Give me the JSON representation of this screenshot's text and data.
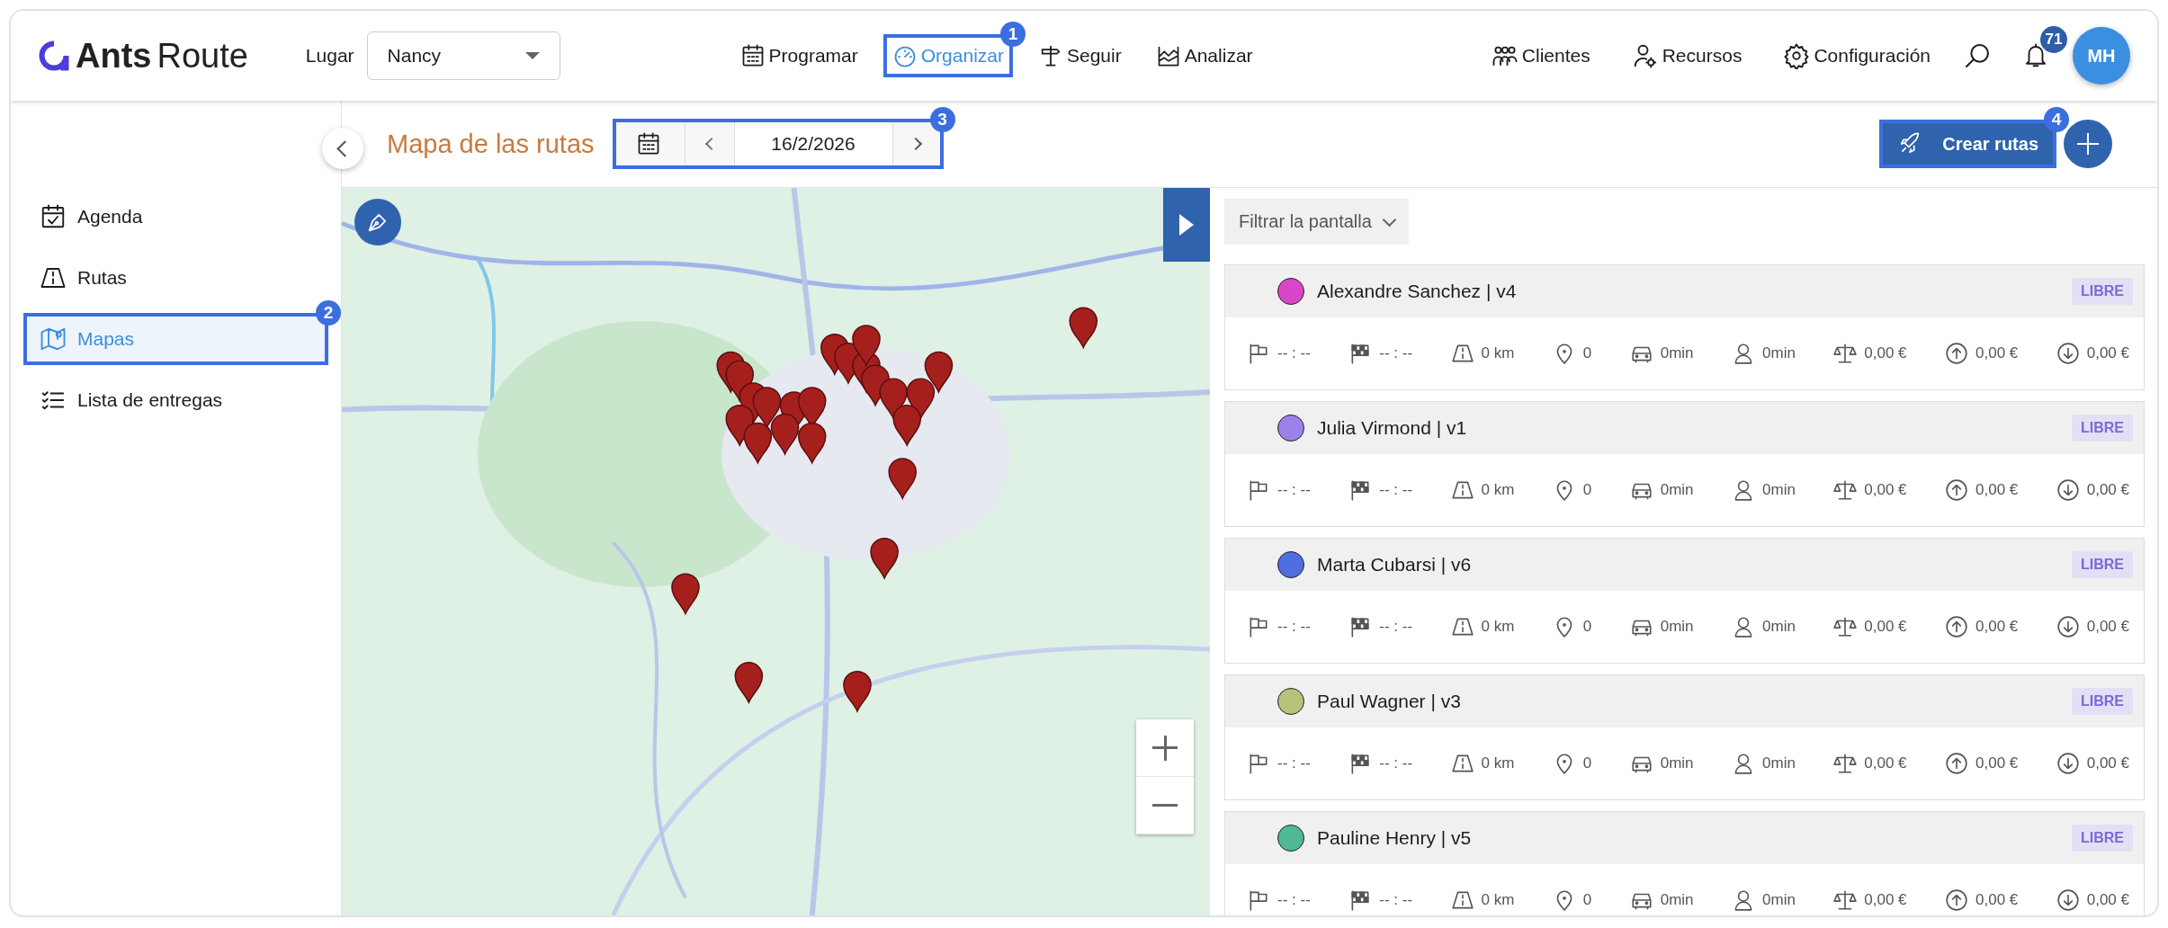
{
  "header": {
    "logo": {
      "bold": "Ants",
      "light": "Route"
    },
    "place": {
      "label": "Lugar",
      "value": "Nancy"
    },
    "nav": [
      {
        "label": "Programar",
        "selected": false
      },
      {
        "label": "Organizar",
        "selected": true,
        "callout": "1"
      },
      {
        "label": "Seguir",
        "selected": false
      },
      {
        "label": "Analizar",
        "selected": false
      }
    ],
    "right_nav": [
      {
        "label": "Clientes"
      },
      {
        "label": "Recursos"
      },
      {
        "label": "Configuración"
      }
    ],
    "notifications": "71",
    "avatar": "MH"
  },
  "sidebar": {
    "items": [
      {
        "label": "Agenda",
        "selected": false
      },
      {
        "label": "Rutas",
        "selected": false
      },
      {
        "label": "Mapas",
        "selected": true,
        "callout": "2"
      },
      {
        "label": "Lista de entregas",
        "selected": false
      }
    ]
  },
  "toolbar": {
    "title": "Mapa de las rutas",
    "date": "16/2/2026",
    "date_callout": "3",
    "create_button": "Crear rutas",
    "create_callout": "4"
  },
  "filter": {
    "label": "Filtrar la pantalla"
  },
  "routes": [
    {
      "name": "Alexandre Sanchez | v4",
      "color": "#d946c8",
      "status": "LIBRE",
      "stats": [
        {
          "kind": "start",
          "value": "-- : --"
        },
        {
          "kind": "end",
          "value": "-- : --"
        },
        {
          "kind": "distance",
          "value": "0 km"
        },
        {
          "kind": "stops",
          "value": "0"
        },
        {
          "kind": "drive",
          "value": "0min"
        },
        {
          "kind": "work",
          "value": "0min"
        },
        {
          "kind": "cost",
          "value": "0,00 €"
        },
        {
          "kind": "revenue",
          "value": "0,00 €"
        },
        {
          "kind": "expense",
          "value": "0,00 €"
        }
      ]
    },
    {
      "name": "Julia Virmond | v1",
      "color": "#9b82ea",
      "status": "LIBRE",
      "stats": [
        {
          "kind": "start",
          "value": "-- : --"
        },
        {
          "kind": "end",
          "value": "-- : --"
        },
        {
          "kind": "distance",
          "value": "0 km"
        },
        {
          "kind": "stops",
          "value": "0"
        },
        {
          "kind": "drive",
          "value": "0min"
        },
        {
          "kind": "work",
          "value": "0min"
        },
        {
          "kind": "cost",
          "value": "0,00 €"
        },
        {
          "kind": "revenue",
          "value": "0,00 €"
        },
        {
          "kind": "expense",
          "value": "0,00 €"
        }
      ]
    },
    {
      "name": "Marta Cubarsi | v6",
      "color": "#4f6fe0",
      "status": "LIBRE",
      "stats": [
        {
          "kind": "start",
          "value": "-- : --"
        },
        {
          "kind": "end",
          "value": "-- : --"
        },
        {
          "kind": "distance",
          "value": "0 km"
        },
        {
          "kind": "stops",
          "value": "0"
        },
        {
          "kind": "drive",
          "value": "0min"
        },
        {
          "kind": "work",
          "value": "0min"
        },
        {
          "kind": "cost",
          "value": "0,00 €"
        },
        {
          "kind": "revenue",
          "value": "0,00 €"
        },
        {
          "kind": "expense",
          "value": "0,00 €"
        }
      ]
    },
    {
      "name": "Paul Wagner | v3",
      "color": "#b9c27a",
      "status": "LIBRE",
      "stats": [
        {
          "kind": "start",
          "value": "-- : --"
        },
        {
          "kind": "end",
          "value": "-- : --"
        },
        {
          "kind": "distance",
          "value": "0 km"
        },
        {
          "kind": "stops",
          "value": "0"
        },
        {
          "kind": "drive",
          "value": "0min"
        },
        {
          "kind": "work",
          "value": "0min"
        },
        {
          "kind": "cost",
          "value": "0,00 €"
        },
        {
          "kind": "revenue",
          "value": "0,00 €"
        },
        {
          "kind": "expense",
          "value": "0,00 €"
        }
      ]
    },
    {
      "name": "Pauline Henry | v5",
      "color": "#4fb894",
      "status": "LIBRE",
      "stats": [
        {
          "kind": "start",
          "value": "-- : --"
        },
        {
          "kind": "end",
          "value": "-- : --"
        },
        {
          "kind": "distance",
          "value": "0 km"
        },
        {
          "kind": "stops",
          "value": "0"
        },
        {
          "kind": "drive",
          "value": "0min"
        },
        {
          "kind": "work",
          "value": "0min"
        },
        {
          "kind": "cost",
          "value": "0,00 €"
        },
        {
          "kind": "revenue",
          "value": "0,00 €"
        },
        {
          "kind": "expense",
          "value": "0,00 €"
        }
      ]
    }
  ]
}
